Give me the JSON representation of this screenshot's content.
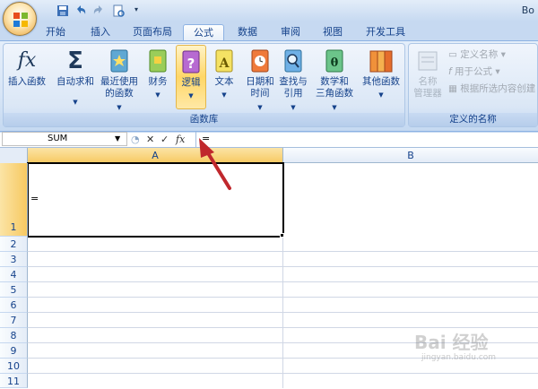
{
  "window": {
    "title_fragment": "Bo"
  },
  "tabs": [
    "开始",
    "插入",
    "页面布局",
    "公式",
    "数据",
    "审阅",
    "视图",
    "开发工具"
  ],
  "active_tab": "公式",
  "ribbon": {
    "function_library": {
      "insert_function": {
        "icon_text": "fx",
        "label": "插入函数"
      },
      "autosum": {
        "icon_text": "Σ",
        "label": "自动求和"
      },
      "recent": {
        "label1": "最近使用",
        "label2": "的函数"
      },
      "financial": {
        "label": "财务"
      },
      "logical": {
        "icon_text": "?",
        "label": "逻辑"
      },
      "text": {
        "icon_text": "A",
        "label": "文本"
      },
      "datetime": {
        "label1": "日期和",
        "label2": "时间"
      },
      "lookup": {
        "label1": "查找与",
        "label2": "引用"
      },
      "math": {
        "icon_text": "θ",
        "label1": "数学和",
        "label2": "三角函数"
      },
      "other": {
        "label": "其他函数"
      },
      "group_label": "函数库"
    },
    "defined_names": {
      "name_manager": {
        "label1": "名称",
        "label2": "管理器"
      },
      "define_name": "定义名称",
      "use_in_formula": "用于公式",
      "create_from_selection": "根据所选内容创建",
      "group_label": "定义的名称"
    }
  },
  "formula_bar": {
    "name_box": "SUM",
    "fx_label": "fx",
    "cancel_glyph": "✕",
    "enter_glyph": "✓",
    "content": "="
  },
  "grid": {
    "columns": [
      "A",
      "B"
    ],
    "rows": [
      "1",
      "2",
      "3",
      "4",
      "5",
      "6",
      "7",
      "8",
      "9",
      "10",
      "11"
    ],
    "active_cell_content": "="
  },
  "watermark": {
    "text": "Bai 经验",
    "sub": "jingyan.baidu.com"
  },
  "colors": {
    "accent": "#15428b",
    "arrow": "#c0282d",
    "selected": "#ffd767"
  }
}
